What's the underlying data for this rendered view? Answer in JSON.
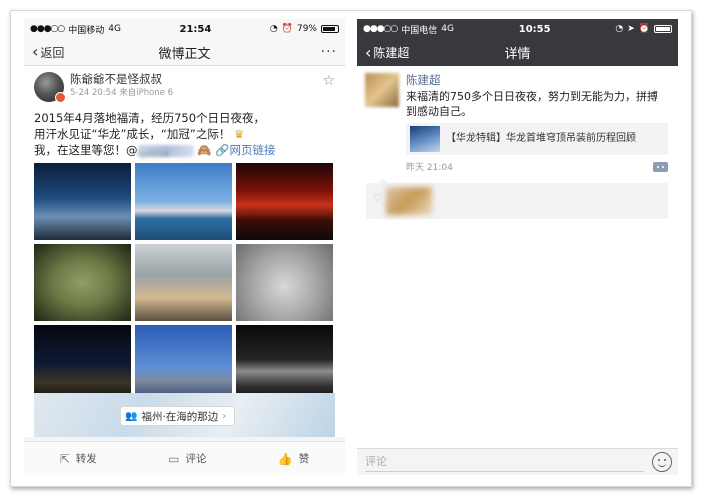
{
  "left": {
    "status": {
      "carrier": "中国移动",
      "network": "4G",
      "time": "21:54",
      "battery": "79%"
    },
    "nav": {
      "back_label": "返回",
      "title": "微博正文",
      "more": "···"
    },
    "post": {
      "author": "陈爺爺不是怪叔叔",
      "time": "5-24 20:54",
      "source": "来自iPhone 6",
      "text_line1": "2015年4月落地福清，经历750个日日夜夜，",
      "text_line2": "用汗水见证“华龙”成长，“加冠”之际！",
      "text_line3_prefix": "我，在这里等您！@",
      "mention_partial": "ty0216",
      "link_label": "网页链接",
      "images": [
        "night-sky-photo",
        "plant-seaside-photo",
        "red-sunset-photo",
        "dome-interior-photo",
        "engineer-desk-photo",
        "dome-structure-photo",
        "night-construction-photo",
        "plant-blue-sky-photo",
        "dome-night-photo"
      ],
      "location": "福州·在海的那边"
    },
    "actions": {
      "repost": "转发",
      "comment": "评论",
      "like": "赞"
    }
  },
  "right": {
    "status": {
      "carrier": "中国电信",
      "network": "4G",
      "time": "10:55"
    },
    "nav": {
      "back_label": "陈建超",
      "title": "详情"
    },
    "moment": {
      "author": "陈建超",
      "text": "来福清的750多个日日夜夜，努力到无能为力，拼搏到感动自己。",
      "share_title": "【华龙特辑】华龙首堆穹顶吊装前历程回顾",
      "time": "昨天 21:04"
    },
    "input": {
      "placeholder": "评论"
    }
  },
  "colors": {
    "wechat_bar": "#38393d",
    "wechat_name": "#576b95",
    "weibo_link": "#4e7bb6"
  }
}
